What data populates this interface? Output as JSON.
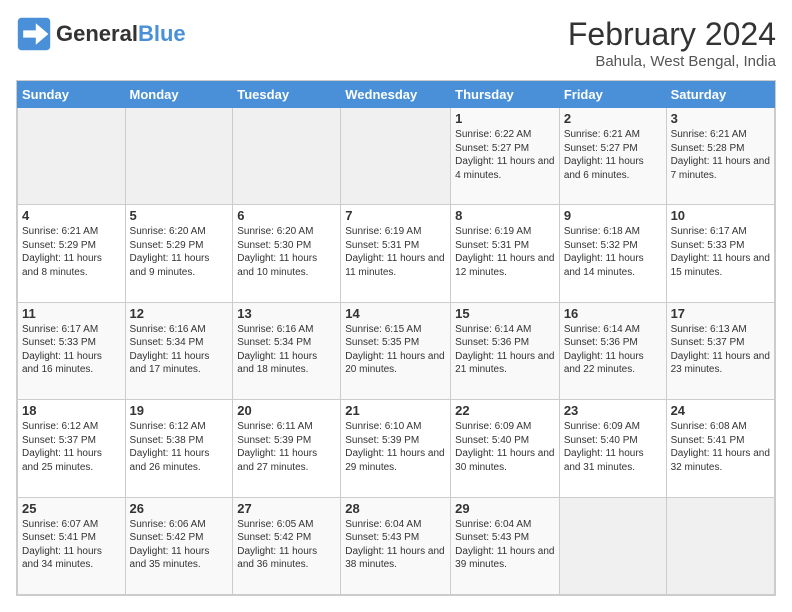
{
  "logo": {
    "general": "General",
    "blue": "Blue"
  },
  "header": {
    "month_year": "February 2024",
    "location": "Bahula, West Bengal, India"
  },
  "weekdays": [
    "Sunday",
    "Monday",
    "Tuesday",
    "Wednesday",
    "Thursday",
    "Friday",
    "Saturday"
  ],
  "weeks": [
    [
      {
        "day": "",
        "text": ""
      },
      {
        "day": "",
        "text": ""
      },
      {
        "day": "",
        "text": ""
      },
      {
        "day": "",
        "text": ""
      },
      {
        "day": "1",
        "text": "Sunrise: 6:22 AM\nSunset: 5:27 PM\nDaylight: 11 hours and 4 minutes."
      },
      {
        "day": "2",
        "text": "Sunrise: 6:21 AM\nSunset: 5:27 PM\nDaylight: 11 hours and 6 minutes."
      },
      {
        "day": "3",
        "text": "Sunrise: 6:21 AM\nSunset: 5:28 PM\nDaylight: 11 hours and 7 minutes."
      }
    ],
    [
      {
        "day": "4",
        "text": "Sunrise: 6:21 AM\nSunset: 5:29 PM\nDaylight: 11 hours and 8 minutes."
      },
      {
        "day": "5",
        "text": "Sunrise: 6:20 AM\nSunset: 5:29 PM\nDaylight: 11 hours and 9 minutes."
      },
      {
        "day": "6",
        "text": "Sunrise: 6:20 AM\nSunset: 5:30 PM\nDaylight: 11 hours and 10 minutes."
      },
      {
        "day": "7",
        "text": "Sunrise: 6:19 AM\nSunset: 5:31 PM\nDaylight: 11 hours and 11 minutes."
      },
      {
        "day": "8",
        "text": "Sunrise: 6:19 AM\nSunset: 5:31 PM\nDaylight: 11 hours and 12 minutes."
      },
      {
        "day": "9",
        "text": "Sunrise: 6:18 AM\nSunset: 5:32 PM\nDaylight: 11 hours and 14 minutes."
      },
      {
        "day": "10",
        "text": "Sunrise: 6:17 AM\nSunset: 5:33 PM\nDaylight: 11 hours and 15 minutes."
      }
    ],
    [
      {
        "day": "11",
        "text": "Sunrise: 6:17 AM\nSunset: 5:33 PM\nDaylight: 11 hours and 16 minutes."
      },
      {
        "day": "12",
        "text": "Sunrise: 6:16 AM\nSunset: 5:34 PM\nDaylight: 11 hours and 17 minutes."
      },
      {
        "day": "13",
        "text": "Sunrise: 6:16 AM\nSunset: 5:34 PM\nDaylight: 11 hours and 18 minutes."
      },
      {
        "day": "14",
        "text": "Sunrise: 6:15 AM\nSunset: 5:35 PM\nDaylight: 11 hours and 20 minutes."
      },
      {
        "day": "15",
        "text": "Sunrise: 6:14 AM\nSunset: 5:36 PM\nDaylight: 11 hours and 21 minutes."
      },
      {
        "day": "16",
        "text": "Sunrise: 6:14 AM\nSunset: 5:36 PM\nDaylight: 11 hours and 22 minutes."
      },
      {
        "day": "17",
        "text": "Sunrise: 6:13 AM\nSunset: 5:37 PM\nDaylight: 11 hours and 23 minutes."
      }
    ],
    [
      {
        "day": "18",
        "text": "Sunrise: 6:12 AM\nSunset: 5:37 PM\nDaylight: 11 hours and 25 minutes."
      },
      {
        "day": "19",
        "text": "Sunrise: 6:12 AM\nSunset: 5:38 PM\nDaylight: 11 hours and 26 minutes."
      },
      {
        "day": "20",
        "text": "Sunrise: 6:11 AM\nSunset: 5:39 PM\nDaylight: 11 hours and 27 minutes."
      },
      {
        "day": "21",
        "text": "Sunrise: 6:10 AM\nSunset: 5:39 PM\nDaylight: 11 hours and 29 minutes."
      },
      {
        "day": "22",
        "text": "Sunrise: 6:09 AM\nSunset: 5:40 PM\nDaylight: 11 hours and 30 minutes."
      },
      {
        "day": "23",
        "text": "Sunrise: 6:09 AM\nSunset: 5:40 PM\nDaylight: 11 hours and 31 minutes."
      },
      {
        "day": "24",
        "text": "Sunrise: 6:08 AM\nSunset: 5:41 PM\nDaylight: 11 hours and 32 minutes."
      }
    ],
    [
      {
        "day": "25",
        "text": "Sunrise: 6:07 AM\nSunset: 5:41 PM\nDaylight: 11 hours and 34 minutes."
      },
      {
        "day": "26",
        "text": "Sunrise: 6:06 AM\nSunset: 5:42 PM\nDaylight: 11 hours and 35 minutes."
      },
      {
        "day": "27",
        "text": "Sunrise: 6:05 AM\nSunset: 5:42 PM\nDaylight: 11 hours and 36 minutes."
      },
      {
        "day": "28",
        "text": "Sunrise: 6:04 AM\nSunset: 5:43 PM\nDaylight: 11 hours and 38 minutes."
      },
      {
        "day": "29",
        "text": "Sunrise: 6:04 AM\nSunset: 5:43 PM\nDaylight: 11 hours and 39 minutes."
      },
      {
        "day": "",
        "text": ""
      },
      {
        "day": "",
        "text": ""
      }
    ]
  ]
}
